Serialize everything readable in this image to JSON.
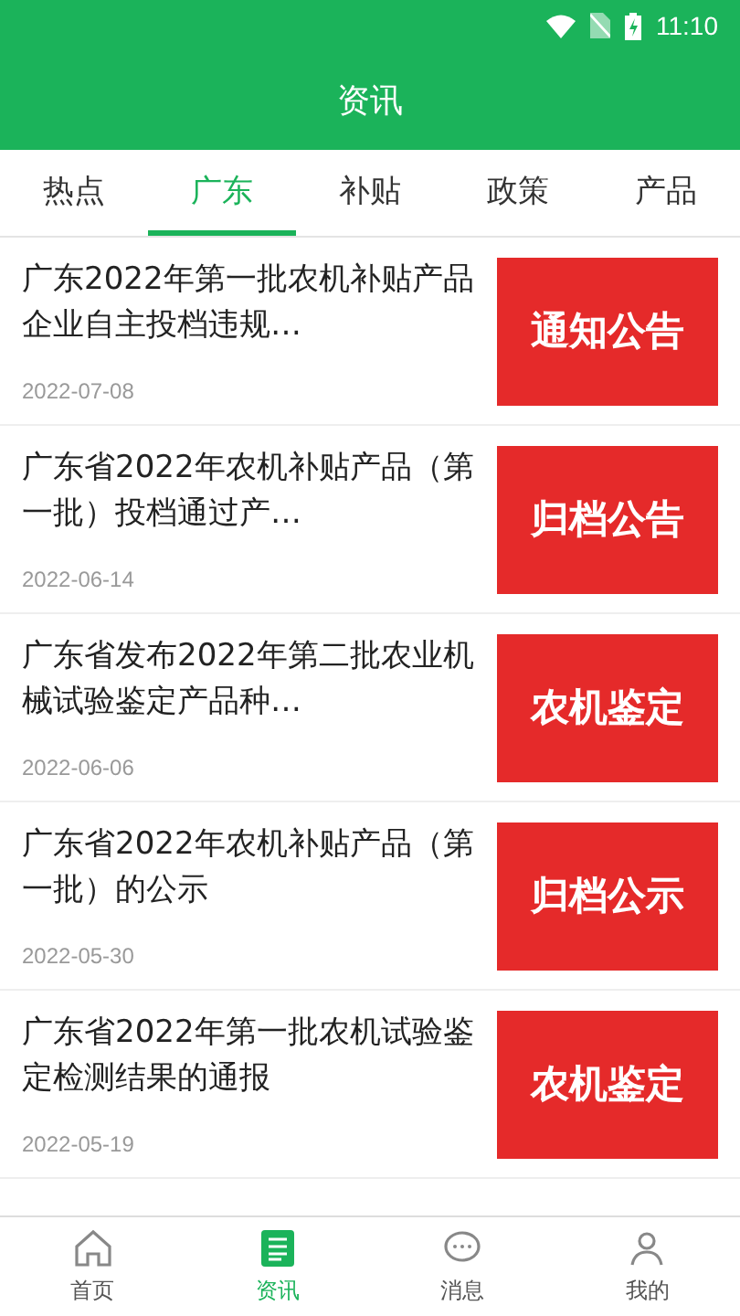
{
  "status_bar": {
    "time": "11:10"
  },
  "header": {
    "title": "资讯"
  },
  "tabs": [
    {
      "label": "热点",
      "selected": false
    },
    {
      "label": "广东",
      "selected": true
    },
    {
      "label": "补贴",
      "selected": false
    },
    {
      "label": "政策",
      "selected": false
    },
    {
      "label": "产品",
      "selected": false
    }
  ],
  "articles": [
    {
      "title": "广东2022年第一批农机补贴产品企业自主投档违规…",
      "date": "2022-07-08",
      "banner": "通知公告"
    },
    {
      "title": "广东省2022年农机补贴产品（第一批）投档通过产…",
      "date": "2022-06-14",
      "banner": "归档公告"
    },
    {
      "title": "广东省发布2022年第二批农业机械试验鉴定产品种…",
      "date": "2022-06-06",
      "banner": "农机鉴定"
    },
    {
      "title": "广东省2022年农机补贴产品（第一批）的公示",
      "date": "2022-05-30",
      "banner": "归档公示"
    },
    {
      "title": "广东省2022年第一批农机试验鉴定检测结果的通报",
      "date": "2022-05-19",
      "banner": "农机鉴定"
    }
  ],
  "bottom_nav": [
    {
      "label": "首页",
      "kind": "home",
      "selected": false
    },
    {
      "label": "资讯",
      "kind": "news",
      "selected": true
    },
    {
      "label": "消息",
      "kind": "message",
      "selected": false
    },
    {
      "label": "我的",
      "kind": "profile",
      "selected": false
    }
  ]
}
